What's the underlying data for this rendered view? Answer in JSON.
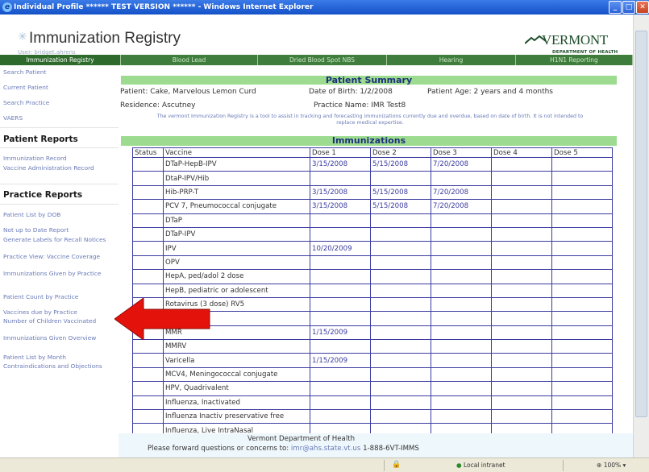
{
  "window": {
    "title": "Individual Profile ****** TEST VERSION ****** - Windows Internet Explorer"
  },
  "header": {
    "app_title": "Immunization Registry",
    "user": "User: bridget.ahrens",
    "logo_name": "VERMONT",
    "logo_dept": "DEPARTMENT OF HEALTH"
  },
  "nav": {
    "tabs": [
      "Immunization Registry",
      "Blood Lead",
      "Dried Blood Spot NBS",
      "Hearing",
      "H1N1 Reporting"
    ]
  },
  "sidebar": {
    "top_links": [
      "Search Patient",
      "Current Patient",
      "Search Practice",
      "VAERS"
    ],
    "patient_reports_heading": "Patient Reports",
    "patient_reports": [
      "Immunization Record",
      "Vaccine Administration Record"
    ],
    "practice_reports_heading": "Practice Reports",
    "practice_reports": [
      "Patient List by DOB",
      "Not up to Date Report",
      "Generate Labels for Recall Notices",
      "Practice View: Vaccine Coverage",
      "Immunizations Given by Practice",
      "Patient Count by Practice",
      "Vaccines due by Practice",
      "Number of Children Vaccinated",
      "Immunizations Given Overview",
      "Patient List by Month",
      "Contraindications and Objections"
    ]
  },
  "summary": {
    "heading": "Patient Summary",
    "patient": "Patient: Cake, Marvelous Lemon Curd",
    "dob": "Date of Birth: 1/2/2008",
    "age": "Patient Age: 2 years and 4 months",
    "residence": "Residence: Ascutney",
    "practice": "Practice Name: IMR Test8",
    "disclaimer": "The vermont Immunization Registry is a tool to assist in tracking and forecasting immunizations currently due and overdue, based on date of birth. It is not intended to replace medical expertise."
  },
  "immunizations": {
    "heading": "Immunizations",
    "columns": [
      "Status",
      "Vaccine",
      "Dose 1",
      "Dose 2",
      "Dose 3",
      "Dose 4",
      "Dose 5"
    ],
    "rows": [
      [
        "",
        "DTaP-HepB-IPV",
        "3/15/2008",
        "5/15/2008",
        "7/20/2008",
        "",
        ""
      ],
      [
        "",
        "DtaP-IPV/Hib",
        "",
        "",
        "",
        "",
        ""
      ],
      [
        "",
        "Hib-PRP-T",
        "3/15/2008",
        "5/15/2008",
        "7/20/2008",
        "",
        ""
      ],
      [
        "",
        "PCV 7, Pneumococcal conjugate",
        "3/15/2008",
        "5/15/2008",
        "7/20/2008",
        "",
        ""
      ],
      [
        "",
        "DTaP",
        "",
        "",
        "",
        "",
        ""
      ],
      [
        "",
        "DTaP-IPV",
        "",
        "",
        "",
        "",
        ""
      ],
      [
        "",
        "IPV",
        "10/20/2009",
        "",
        "",
        "",
        ""
      ],
      [
        "",
        "OPV",
        "",
        "",
        "",
        "",
        ""
      ],
      [
        "",
        "HepA, ped/adol 2 dose",
        "",
        "",
        "",
        "",
        ""
      ],
      [
        "",
        "HepB, pediatric or adolescent",
        "",
        "",
        "",
        "",
        ""
      ],
      [
        "",
        "Rotavirus (3 dose) RV5",
        "",
        "",
        "",
        "",
        ""
      ],
      [
        "",
        "1",
        "",
        "",
        "",
        "",
        ""
      ],
      [
        "",
        "MMR",
        "1/15/2009",
        "",
        "",
        "",
        ""
      ],
      [
        "",
        "MMRV",
        "",
        "",
        "",
        "",
        ""
      ],
      [
        "",
        "Varicella",
        "1/15/2009",
        "",
        "",
        "",
        ""
      ],
      [
        "",
        "MCV4, Meningococcal conjugate",
        "",
        "",
        "",
        "",
        ""
      ],
      [
        "",
        "HPV, Quadrivalent",
        "",
        "",
        "",
        "",
        ""
      ],
      [
        "",
        "Influenza, Inactivated",
        "",
        "",
        "",
        "",
        ""
      ],
      [
        "",
        "Influenza Inactiv preservative free",
        "",
        "",
        "",
        "",
        ""
      ],
      [
        "",
        "Influenza, Live IntraNasal",
        "",
        "",
        "",
        "",
        ""
      ]
    ]
  },
  "footer": {
    "dept": "Vermont Department of Health",
    "contact_prefix": "Please forward questions or concerns to:",
    "email": "imr@ahs.state.vt.us",
    "phone": "1-888-6VT-IMMS"
  },
  "statusbar": {
    "zone": "Local intranet",
    "zoom": "100%"
  },
  "colors": {
    "nav_green": "#3e7d3c",
    "header_green": "#9ddc90",
    "link_blue": "#6a7bb8",
    "arrow_red": "#e3120b"
  }
}
